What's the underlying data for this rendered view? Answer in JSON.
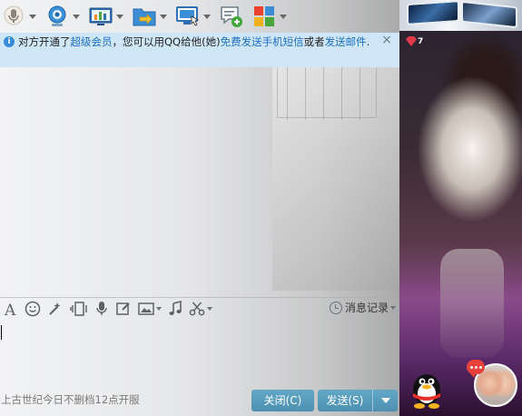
{
  "toolbar": {
    "items": [
      {
        "icon": "microphone-icon"
      },
      {
        "icon": "webcam-icon"
      },
      {
        "icon": "screen-share-icon"
      },
      {
        "icon": "file-transfer-icon"
      },
      {
        "icon": "remote-desktop-icon"
      },
      {
        "icon": "add-chat-icon"
      },
      {
        "icon": "apps-icon"
      }
    ]
  },
  "notice": {
    "text1": "对方开通了",
    "link1": "超级会员",
    "text2": "，您可以用QQ给他(她)",
    "link2": "免费发送手机短信",
    "text3": "或者",
    "link3": "发送邮件",
    "text4": "."
  },
  "input_toolbar": {
    "history_label": "消息记录"
  },
  "footer": {
    "text": "上古世纪今日不删档12点开服",
    "close_label": "关闭(C)",
    "send_label": "发送(S)"
  },
  "side": {
    "vip_level": "7"
  },
  "colors": {
    "notice_bg": "#cfe6f7",
    "link": "#1e6fc0",
    "button": "#5a9dbd"
  }
}
